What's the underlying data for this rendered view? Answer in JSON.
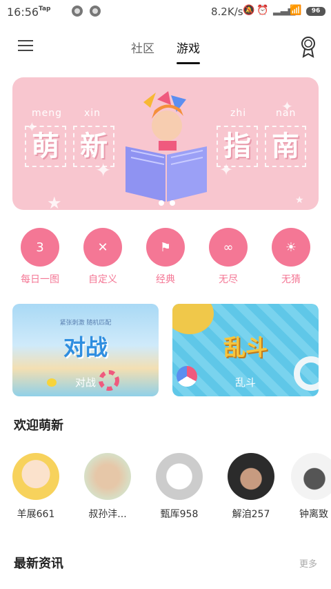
{
  "status": {
    "time": "16:56",
    "tap": "Tap",
    "speed": "8.2K/s",
    "battery": "96"
  },
  "tabs": [
    {
      "label": "社区"
    },
    {
      "label": "游戏"
    }
  ],
  "banner": {
    "pinyin": [
      "meng",
      "xin",
      "zhi",
      "nan"
    ],
    "chars": [
      "萌",
      "新",
      "指",
      "南"
    ]
  },
  "categories": [
    {
      "label": "每日一图",
      "icon": "calendar-3-icon",
      "glyph": "3"
    },
    {
      "label": "自定义",
      "icon": "crossed-pencils-icon",
      "glyph": "✕"
    },
    {
      "label": "经典",
      "icon": "flag-icon",
      "glyph": "⚑"
    },
    {
      "label": "无尽",
      "icon": "infinity-icon",
      "glyph": "∞"
    },
    {
      "label": "无猜",
      "icon": "lightbulb-icon",
      "glyph": "☀"
    }
  ],
  "cards": [
    {
      "title": "对战",
      "subtitle": "紧张刺激 随机匹配",
      "label": "对战"
    },
    {
      "title": "乱斗",
      "label": "乱斗"
    }
  ],
  "welcome": {
    "title": "欢迎萌新"
  },
  "users": [
    {
      "name": "羊展661"
    },
    {
      "name": "叔孙沣..."
    },
    {
      "name": "甄厍958"
    },
    {
      "name": "解洎257"
    },
    {
      "name": "钟离致"
    }
  ],
  "news": {
    "title": "最新资讯",
    "more": "更多"
  },
  "colors": {
    "accent": "#f47795",
    "banner": "#f8c6cf"
  }
}
